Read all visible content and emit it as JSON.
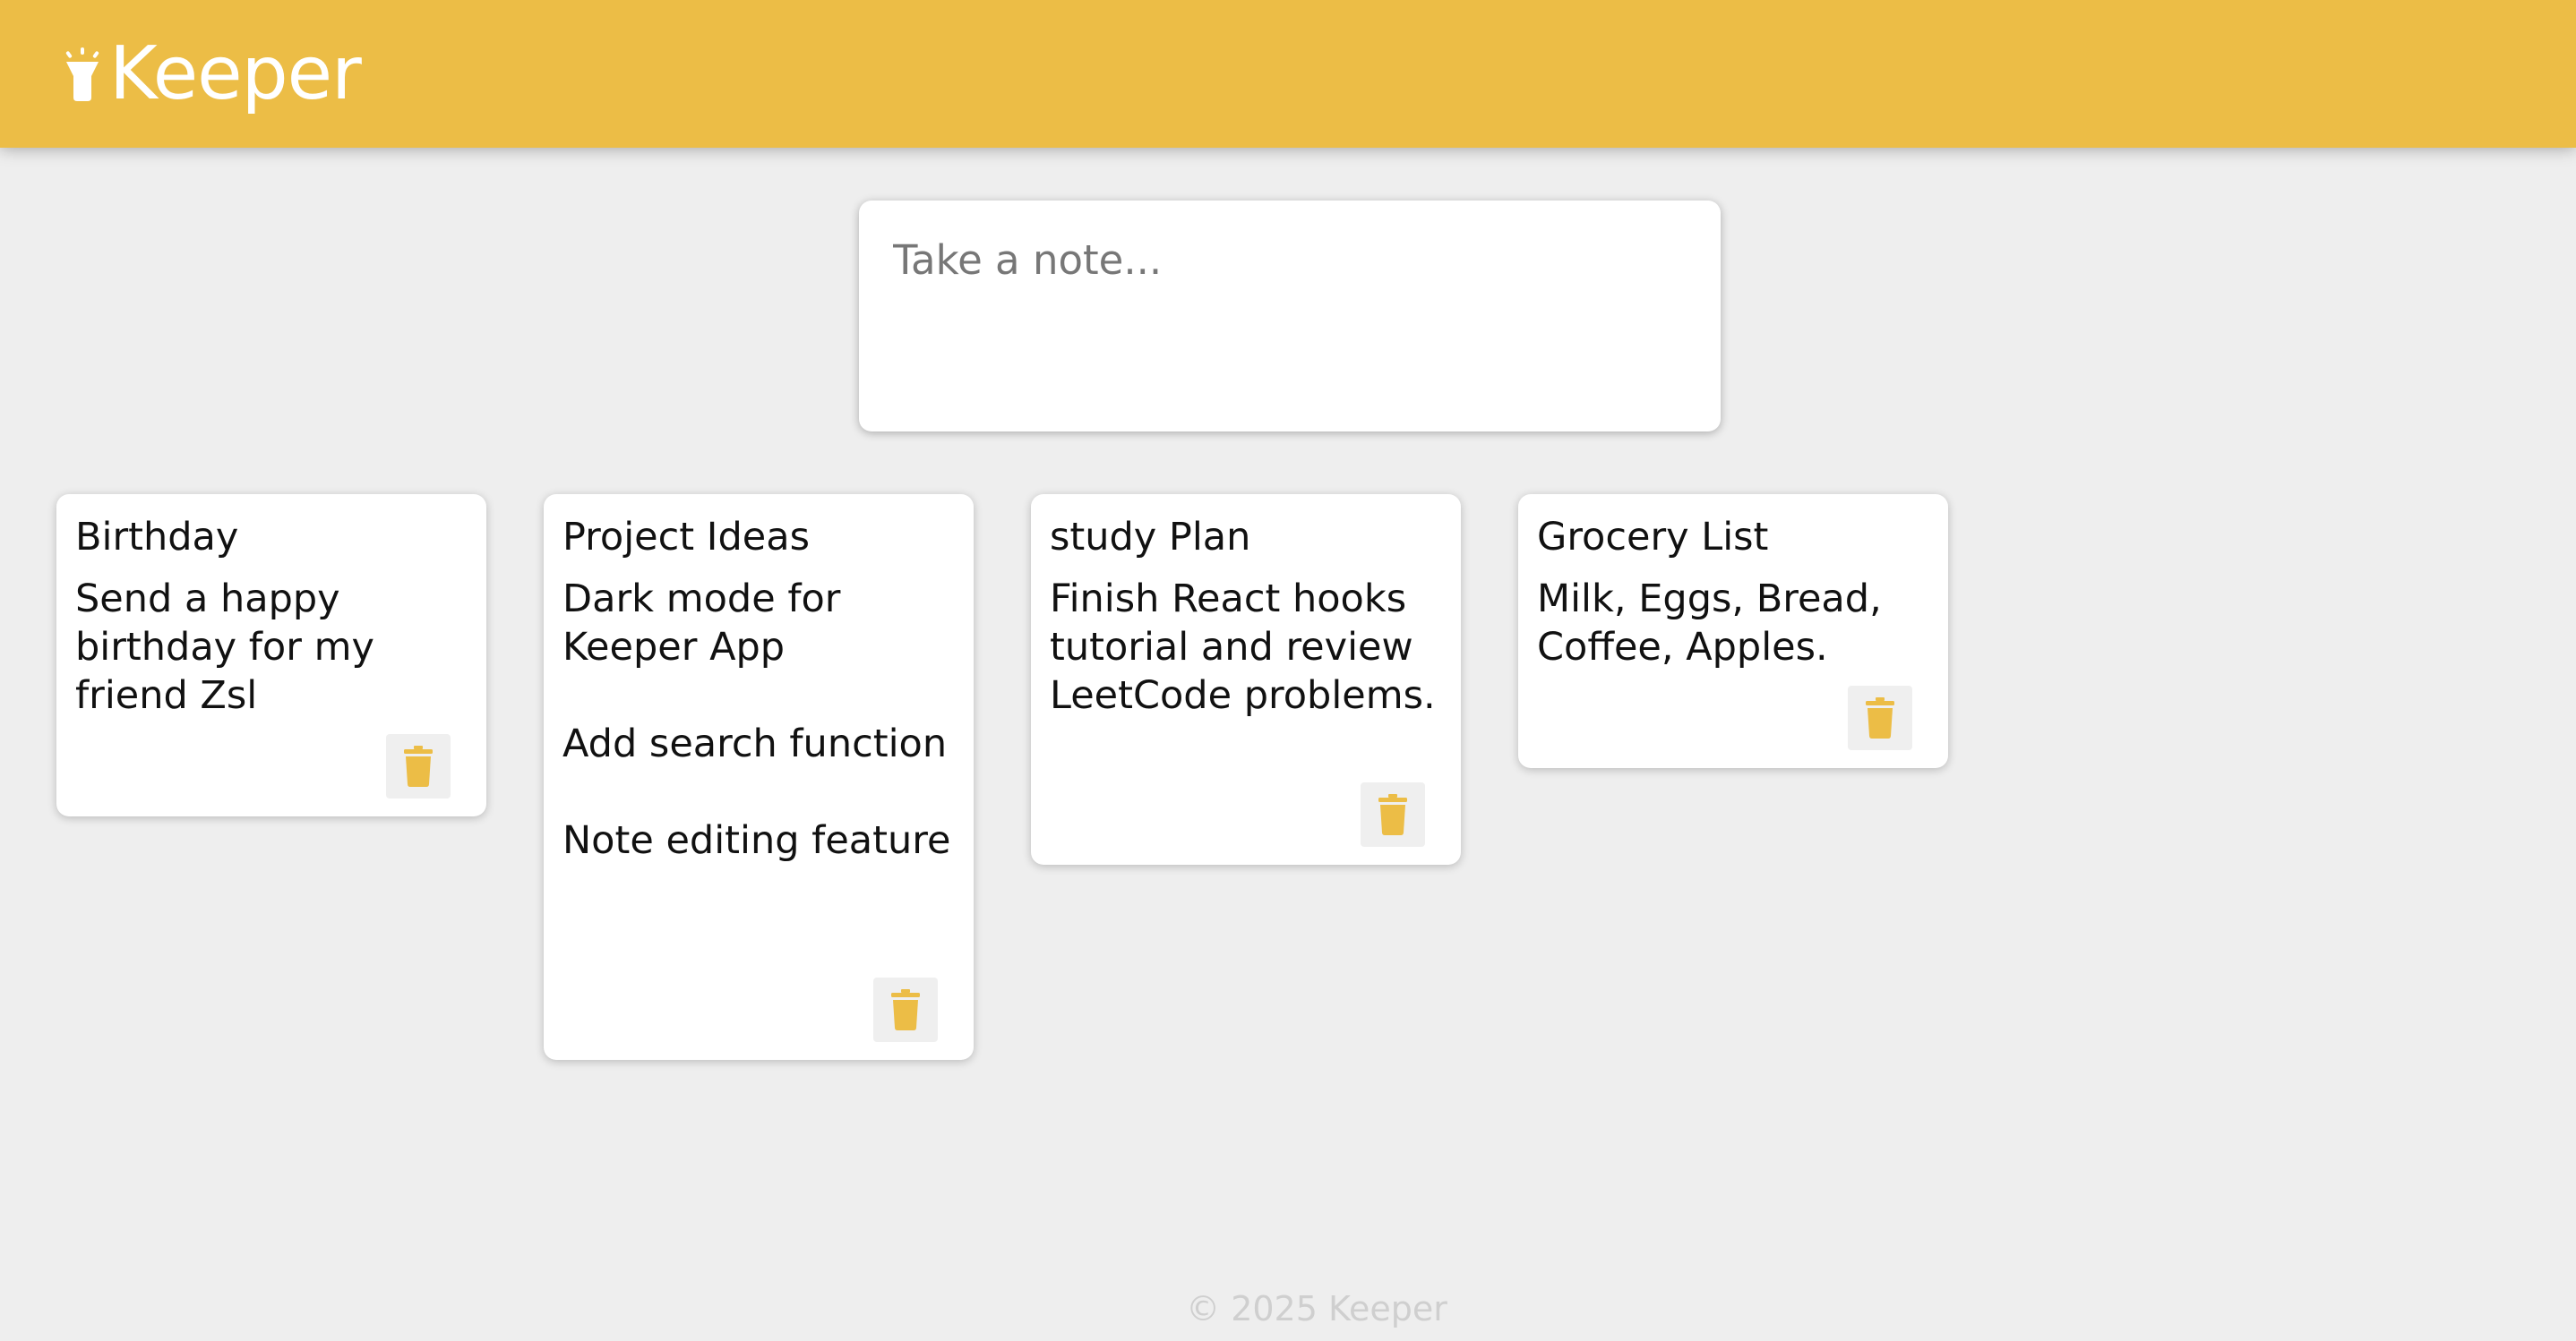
{
  "header": {
    "logo_icon": "flashlight-icon",
    "title": "Keeper",
    "color": "#ecbd46"
  },
  "composer": {
    "placeholder": "Take a note..."
  },
  "notes": [
    {
      "title": "Birthday",
      "content": "Send a happy birthday for my friend Zsl",
      "delete_icon": "trash-icon"
    },
    {
      "title": "Project Ideas",
      "content": "Dark mode for Keeper App\n\nAdd search function\n\nNote editing feature",
      "delete_icon": "trash-icon"
    },
    {
      "title": "study Plan",
      "content": "Finish React hooks tutorial and review LeetCode problems.",
      "delete_icon": "trash-icon"
    },
    {
      "title": "Grocery List",
      "content": "Milk, Eggs, Bread, Coffee, Apples.",
      "delete_icon": "trash-icon"
    }
  ],
  "footer": {
    "text": "© 2025 Keeper"
  },
  "colors": {
    "accent": "#ecbd46",
    "background": "#eeeeee"
  }
}
